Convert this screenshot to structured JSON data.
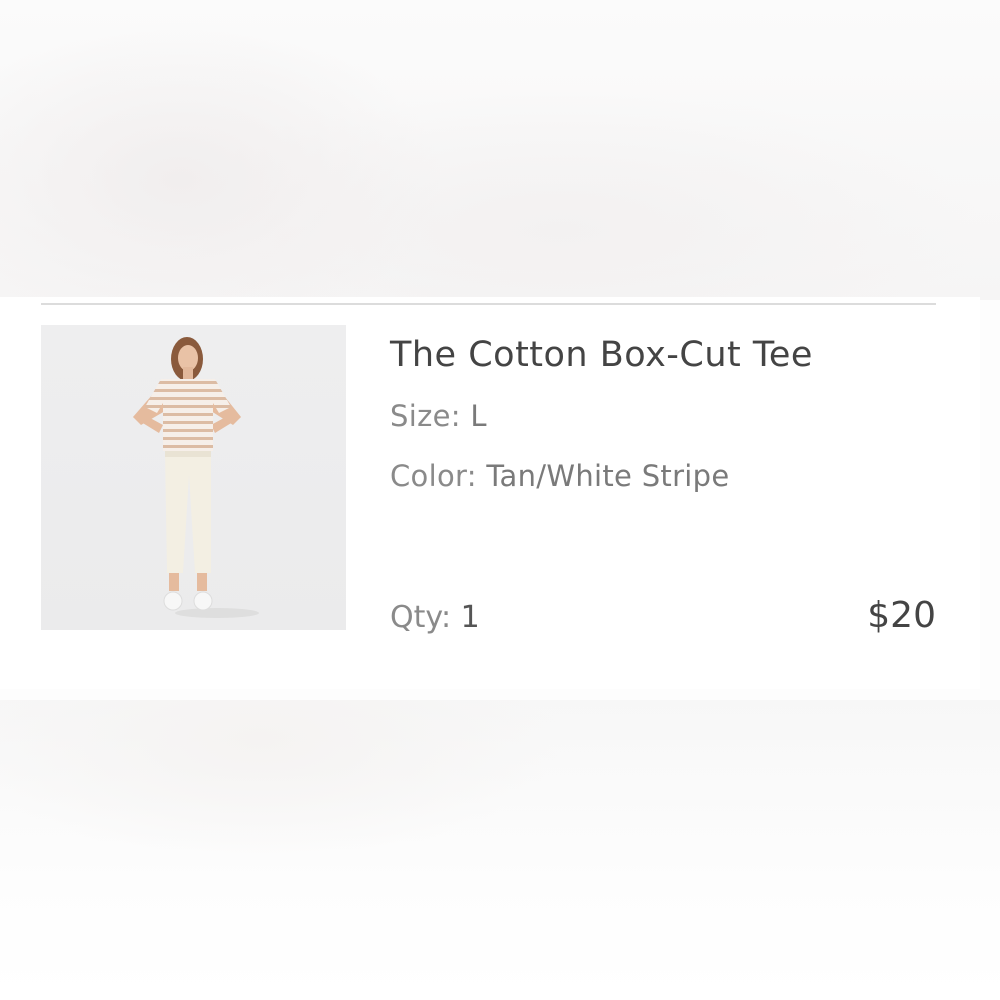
{
  "cart_item": {
    "title": "The Cotton Box-Cut Tee",
    "size_label": "Size:",
    "size_value": "L",
    "color_label": "Color:",
    "color_value": "Tan/White Stripe",
    "qty_label": "Qty:",
    "qty_value": "1",
    "price": "$20",
    "image_icon": "product-photo"
  },
  "colors": {
    "title_text": "#444444",
    "muted_text": "#8a8a8a",
    "divider": "#dcdcdc",
    "stripe": "#d9b9a0"
  }
}
